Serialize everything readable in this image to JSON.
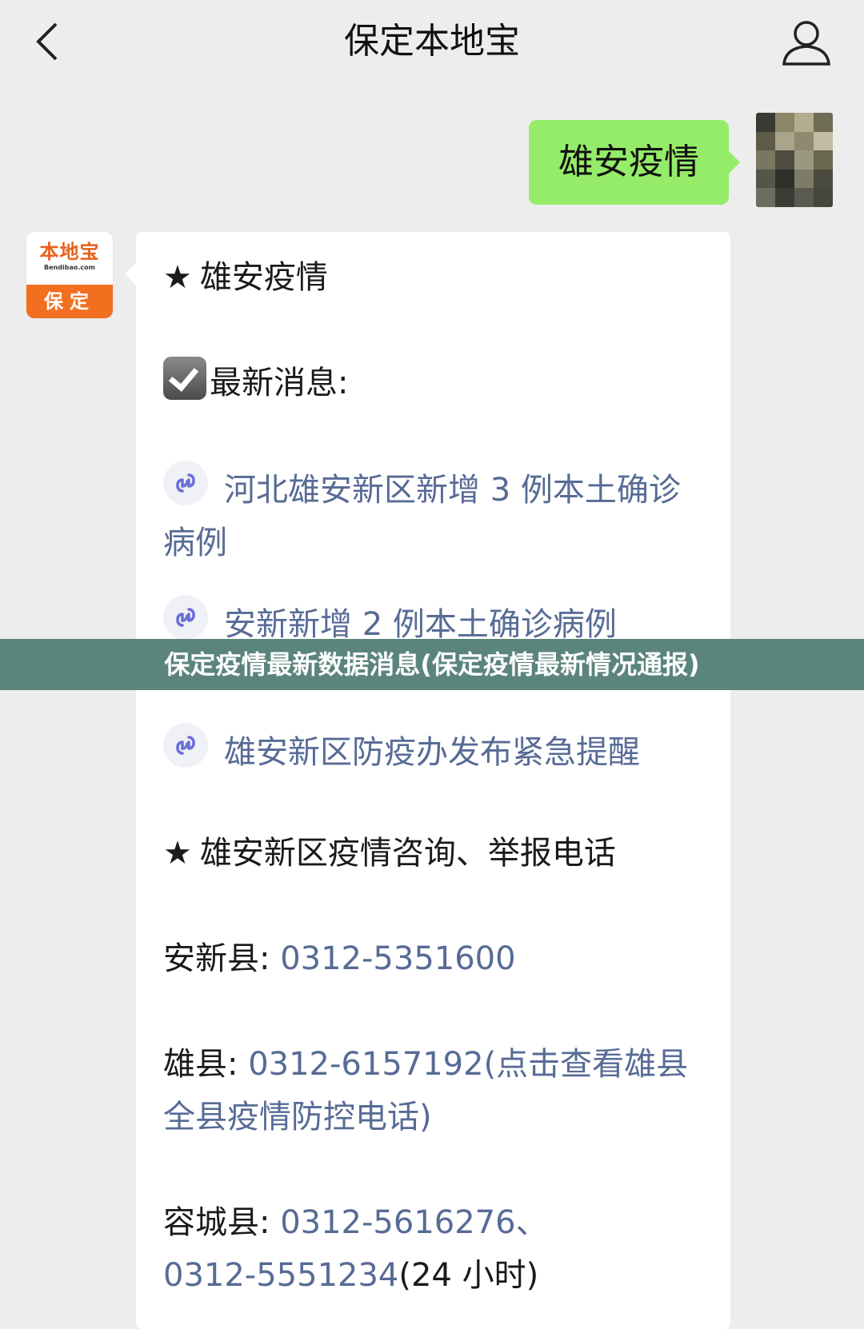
{
  "header": {
    "title": "保定本地宝"
  },
  "user_message": {
    "text": "雄安疫情"
  },
  "bot": {
    "logo_cn": "本地宝",
    "logo_en": "Bendibao.com",
    "logo_city": "保定"
  },
  "card": {
    "heading1": "雄安疫情",
    "latest_label": "最新消息:",
    "link1": "河北雄安新区新增 3 例本土确诊病例",
    "link2": "安新新增 2 例本土确诊病例",
    "link3": "雄安新区防疫办发布紧急提醒",
    "heading2": "雄安新区疫情咨询、举报电话",
    "anxin_label": "安新县:",
    "anxin_phone": "0312-5351600",
    "xiong_label": "雄县:",
    "xiong_phone": "0312-6157192",
    "xiong_link": "(点击查看雄县全县疫情防控电话)",
    "rongcheng_label": "容城县:",
    "rongcheng_phone1": "0312-5616276、",
    "rongcheng_phone2": "0312-5551234",
    "rongcheng_note": "(24 小时)"
  },
  "banner": {
    "text": "保定疫情最新数据消息(保定疫情最新情况通报)"
  },
  "colors": {
    "bubble_green": "#95ec69",
    "link_blue": "#576b95",
    "banner": "#5b847c",
    "brand_orange": "#f36f20"
  },
  "icons": [
    "back-chevron-icon",
    "profile-icon",
    "checkbox-icon",
    "mini-program-link-icon",
    "star-icon"
  ]
}
